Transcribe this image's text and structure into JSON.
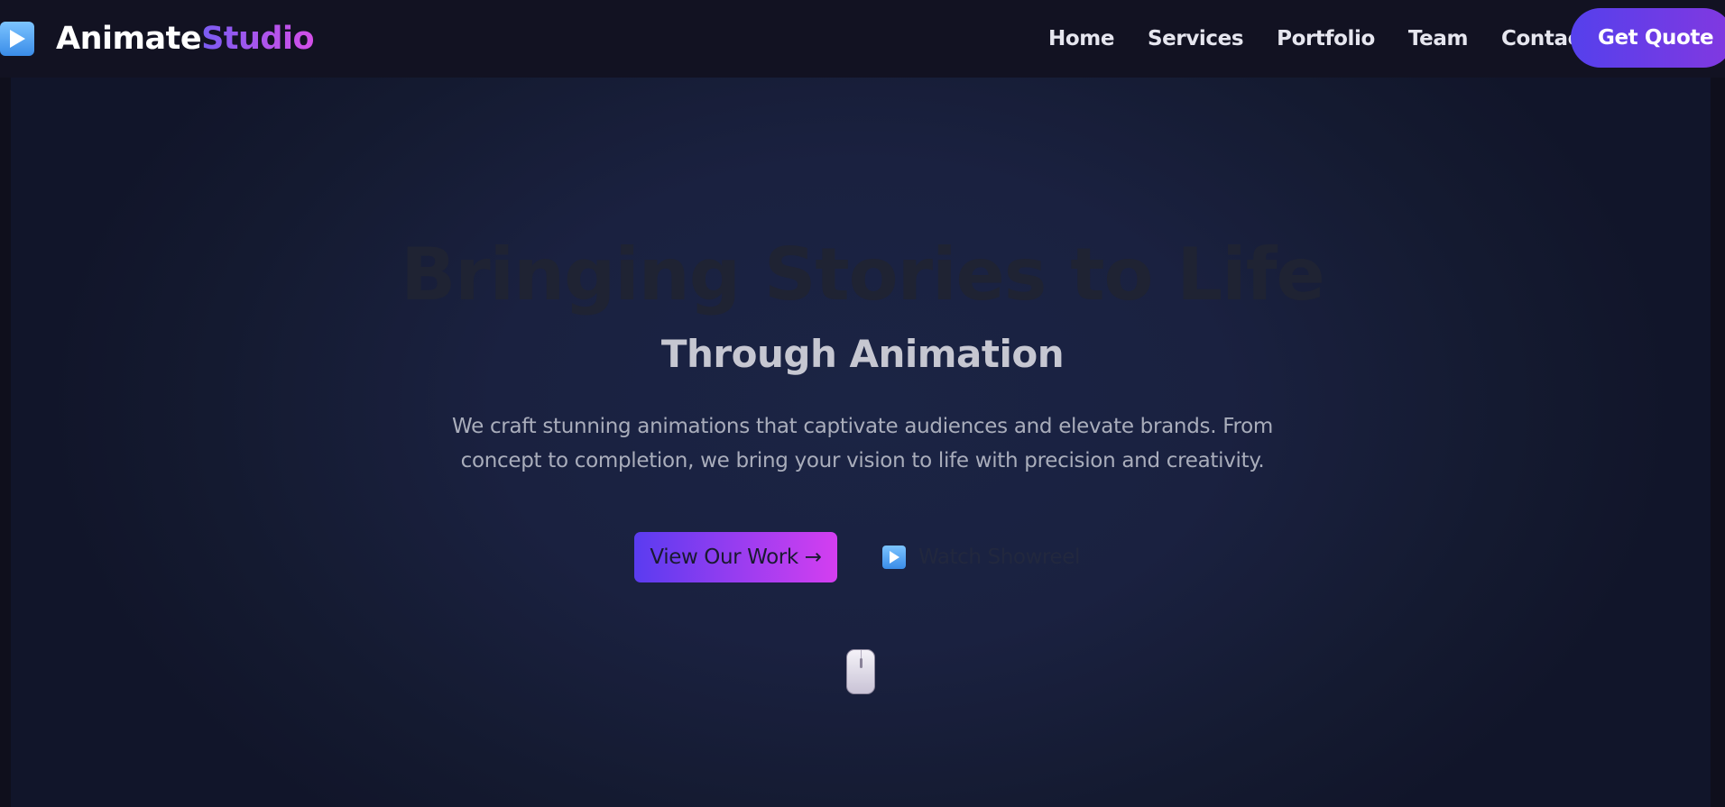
{
  "brand": {
    "name_part1": "Animate",
    "name_part2": "Studio",
    "icon": "play-button-icon"
  },
  "nav": {
    "links": [
      "Home",
      "Services",
      "Portfolio",
      "Team",
      "Contact"
    ],
    "cta_label": "Get Quote"
  },
  "hero": {
    "title": "Bringing Stories to Life",
    "subtitle": "Through Animation",
    "description": "We craft stunning animations that captivate audiences and elevate brands. From concept to completion, we bring your vision to life with precision and creativity.",
    "primary_button": "View Our Work →",
    "secondary_button": "Watch Showreel",
    "secondary_icon": "play-button-icon",
    "scroll_icon": "mouse-icon"
  },
  "colors": {
    "background": "#0f0f1c",
    "nav_background": "#121222",
    "accent_start": "#5540ec",
    "accent_end": "#d44fe8"
  }
}
